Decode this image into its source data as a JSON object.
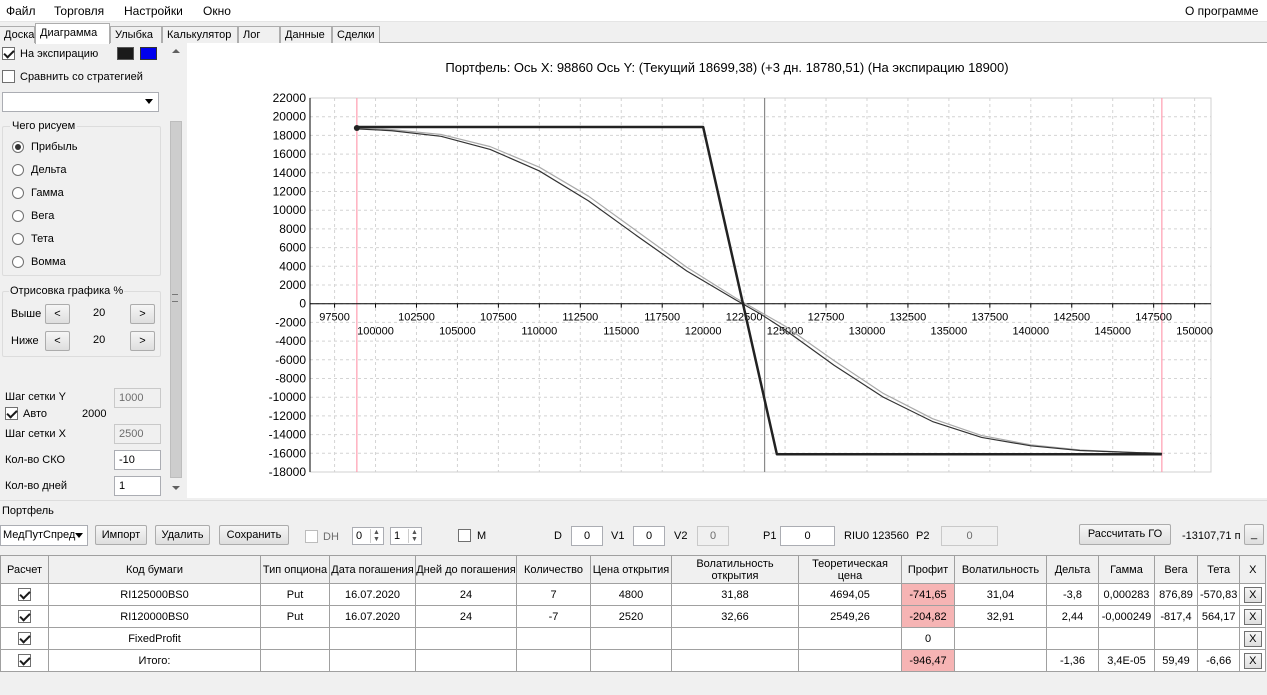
{
  "menu": {
    "file": "Файл",
    "trade": "Торговля",
    "settings": "Настройки",
    "window": "Окно",
    "about": "О программе"
  },
  "tabs": [
    "Доска",
    "Диаграмма",
    "Улыбка",
    "Калькулятор",
    "Лог",
    "Данные",
    "Сделки"
  ],
  "left": {
    "on_expiration": "На экспирацию",
    "compare": "Сравнить со стратегией",
    "what_draw": "Чего рисуем",
    "radios": [
      "Прибыль",
      "Дельта",
      "Гамма",
      "Вега",
      "Тета",
      "Вомма"
    ],
    "draw_group": "Отрисовка графика %",
    "above": "Выше",
    "above_val": "20",
    "below": "Ниже",
    "below_val": "20",
    "grid_y": "Шаг сетки Y",
    "grid_y_val": "1000",
    "auto": "Авто",
    "auto_val": "2000",
    "grid_x": "Шаг сетки X",
    "grid_x_val": "2500",
    "sko": "Кол-во СКО",
    "sko_val": "-10",
    "days": "Кол-во дней",
    "days_val": "1",
    "lt": "<",
    "gt": ">",
    "swatch_black": "#1a1a1a",
    "swatch_blue": "#0000ee"
  },
  "chart_data": {
    "type": "line",
    "title": "Портфель: Ось X: 98860 Ось Y:  (Текущий 18699,38)  (+3 дн. 18780,51)  (На экспирацию 18900)",
    "y_ticks": [
      22000,
      20000,
      18000,
      16000,
      14000,
      12000,
      10000,
      8000,
      6000,
      4000,
      2000,
      0,
      -2000,
      -4000,
      -6000,
      -8000,
      -10000,
      -12000,
      -14000,
      -16000,
      -18000
    ],
    "x_ticks_upper": [
      97500,
      102500,
      107500,
      112500,
      117500,
      122500,
      127500,
      132500,
      137500,
      142500,
      147500
    ],
    "x_ticks_lower": [
      100000,
      105000,
      110000,
      115000,
      120000,
      125000,
      130000,
      135000,
      140000,
      145000,
      150000
    ],
    "xlim": [
      96000,
      151000
    ],
    "ylim": [
      -18000,
      22000
    ],
    "vlines_red": [
      98860,
      148000
    ],
    "vline_gray": 123750,
    "grid": true,
    "series": [
      {
        "x": [
          98860,
          120000,
          124500,
          148000
        ],
        "y": [
          18900,
          18900,
          -16100,
          -16100
        ],
        "color": "#222222",
        "width": 2.5
      },
      {
        "x": [
          98860,
          101000,
          104000,
          107000,
          110000,
          113000,
          116000,
          119000,
          122000,
          123500,
          125000,
          128000,
          131000,
          134000,
          137000,
          140000,
          143000,
          146000,
          148000
        ],
        "y": [
          18700,
          18500,
          17900,
          16500,
          14200,
          11000,
          7200,
          3500,
          400,
          -1100,
          -2800,
          -6600,
          -10000,
          -12600,
          -14300,
          -15200,
          -15700,
          -15900,
          -16000
        ],
        "color": "#333333",
        "width": 1.2
      },
      {
        "x": [
          98860,
          101000,
          104000,
          107000,
          110000,
          113000,
          116000,
          119000,
          122000,
          123500,
          125000,
          128000,
          131000,
          134000,
          137000,
          140000,
          143000,
          146000,
          148000
        ],
        "y": [
          18780,
          18620,
          18100,
          16800,
          14600,
          11500,
          7700,
          3900,
          600,
          -900,
          -2400,
          -6100,
          -9600,
          -12300,
          -14100,
          -15100,
          -15650,
          -15900,
          -16000
        ],
        "color": "#aaaaaa",
        "width": 1.2
      }
    ]
  },
  "portfolio": {
    "label": "Портфель",
    "strategy": "МедПутСпред",
    "import": "Импорт",
    "delete": "Удалить",
    "save": "Сохранить",
    "dh": "DH",
    "dh_a": "0",
    "dh_b": "1",
    "m": "M",
    "d": "D",
    "d_val": "0",
    "v1": "V1",
    "v1_val": "0",
    "v2": "V2",
    "v2_val": "0",
    "p1": "P1",
    "p1_val": "0",
    "riu": "RIU0 123560",
    "p2": "P2",
    "p2_val": "0",
    "calc_go": "Рассчитать ГО",
    "go_val": "-13107,71 п",
    "min_btn": "_"
  },
  "table": {
    "headers": [
      "Расчет",
      "Код бумаги",
      "Тип опциона",
      "Дата погашения",
      "Дней до погашения",
      "Количество",
      "Цена открытия",
      "Волатильность открытия",
      "Теоретическая цена",
      "Профит",
      "Волатильность",
      "Дельта",
      "Гамма",
      "Вега",
      "Тета",
      "X"
    ],
    "rows": [
      {
        "check": true,
        "code": "RI125000BS0",
        "type": "Put",
        "date": "16.07.2020",
        "days": "24",
        "qty": "7",
        "price": "4800",
        "vol_open": "31,88",
        "theor": "4694,05",
        "profit": "-741,65",
        "vol": "31,04",
        "delta": "-3,8",
        "gamma": "0,000283",
        "vega": "876,89",
        "theta": "-570,83",
        "x": "X"
      },
      {
        "check": true,
        "code": "RI120000BS0",
        "type": "Put",
        "date": "16.07.2020",
        "days": "24",
        "qty": "-7",
        "price": "2520",
        "vol_open": "32,66",
        "theor": "2549,26",
        "profit": "-204,82",
        "vol": "32,91",
        "delta": "2,44",
        "gamma": "-0,000249",
        "vega": "-817,4",
        "theta": "564,17",
        "x": "X"
      },
      {
        "check": true,
        "code": "FixedProfit",
        "type": "",
        "date": "",
        "days": "",
        "qty": "",
        "price": "",
        "vol_open": "",
        "theor": "",
        "profit": "0",
        "vol": "",
        "delta": "",
        "gamma": "",
        "vega": "",
        "theta": "",
        "x": "X"
      },
      {
        "check": true,
        "code": "Итого:",
        "type": "",
        "date": "",
        "days": "",
        "qty": "",
        "price": "",
        "vol_open": "",
        "theor": "",
        "profit": "-946,47",
        "vol": "",
        "delta": "-1,36",
        "gamma": "3,4E-05",
        "vega": "59,49",
        "theta": "-6,66",
        "x": "X"
      }
    ]
  }
}
